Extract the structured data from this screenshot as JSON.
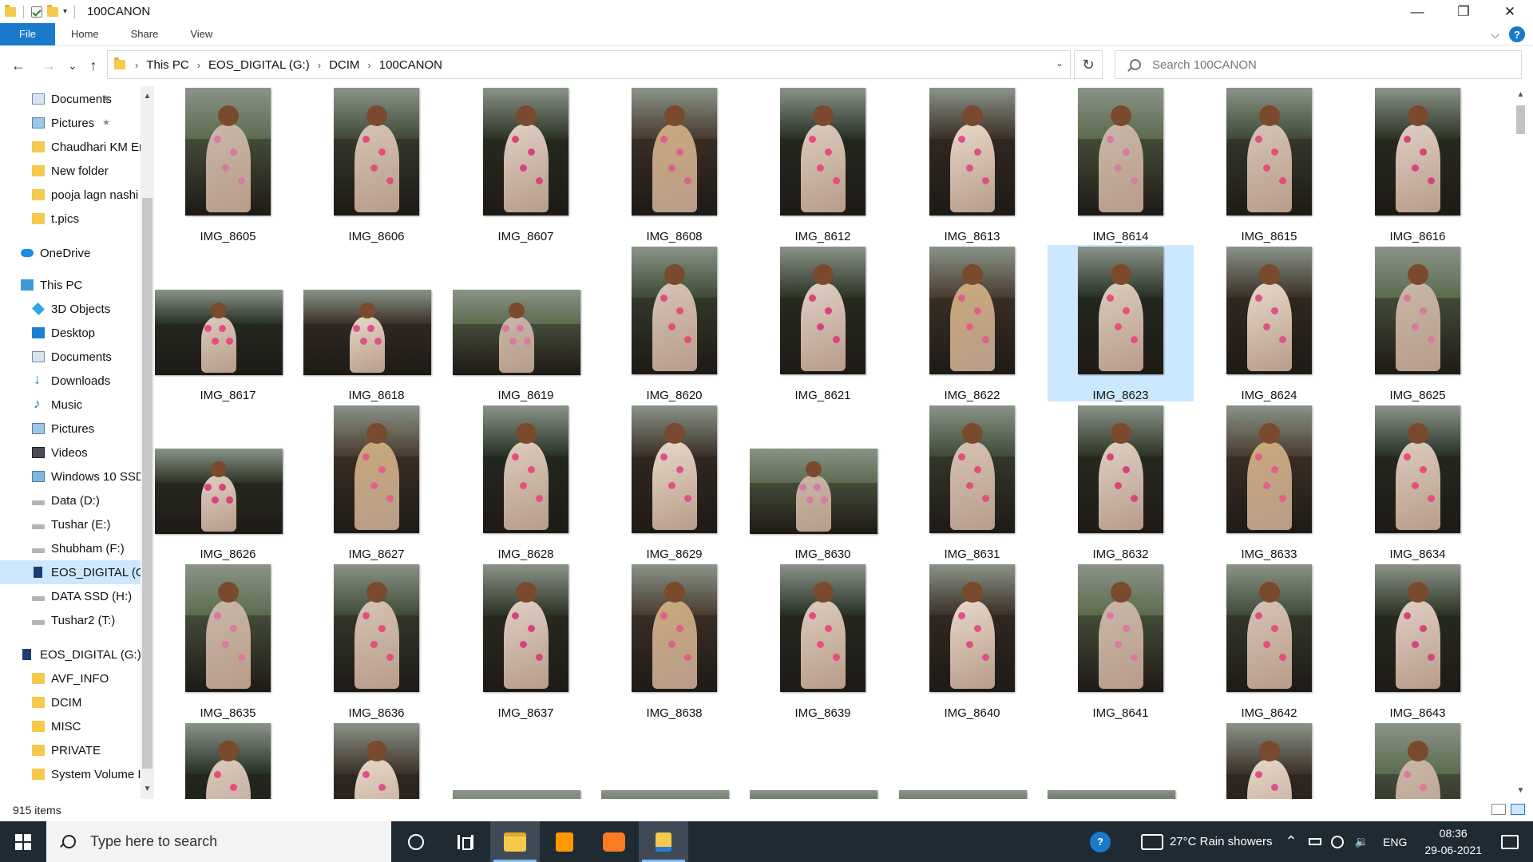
{
  "window": {
    "title": "100CANON",
    "controls": {
      "minimize": "—",
      "maximize": "❐",
      "close": "✕"
    },
    "help": "?"
  },
  "ribbon": {
    "tabs": [
      "File",
      "Home",
      "Share",
      "View"
    ],
    "expand": "⌵"
  },
  "nav": {
    "back": "←",
    "forward": "→",
    "recent": "⌄",
    "up": "↑"
  },
  "address": {
    "breadcrumbs": [
      "This PC",
      "EOS_DIGITAL (G:)",
      "DCIM",
      "100CANON"
    ],
    "separator": "›",
    "dropdown": "⌄",
    "refresh": "↻"
  },
  "search": {
    "placeholder": "Search 100CANON"
  },
  "sidebar": {
    "items": [
      {
        "label": "Documents",
        "icon": "documents-icon",
        "pinned": "★"
      },
      {
        "label": "Pictures",
        "icon": "pictures-icon",
        "pinned": "★"
      },
      {
        "label": "Chaudhari KM En",
        "icon": "folder-icon"
      },
      {
        "label": "New folder",
        "icon": "folder-icon"
      },
      {
        "label": "pooja lagn nashi",
        "icon": "folder-icon"
      },
      {
        "label": "t.pics",
        "icon": "folder-icon"
      },
      {
        "label": "OneDrive",
        "icon": "onedrive-icon"
      },
      {
        "label": "This PC",
        "icon": "this-pc-icon"
      },
      {
        "label": "3D Objects",
        "icon": "3d-objects-icon"
      },
      {
        "label": "Desktop",
        "icon": "desktop-icon"
      },
      {
        "label": "Documents",
        "icon": "documents-icon"
      },
      {
        "label": "Downloads",
        "icon": "downloads-icon"
      },
      {
        "label": "Music",
        "icon": "music-icon"
      },
      {
        "label": "Pictures",
        "icon": "pictures-icon"
      },
      {
        "label": "Videos",
        "icon": "videos-icon"
      },
      {
        "label": "Windows 10 SSD",
        "icon": "windows-drive-icon"
      },
      {
        "label": "Data (D:)",
        "icon": "drive-icon"
      },
      {
        "label": "Tushar (E:)",
        "icon": "drive-icon"
      },
      {
        "label": "Shubham (F:)",
        "icon": "drive-icon"
      },
      {
        "label": "EOS_DIGITAL (G:)",
        "icon": "sd-card-icon",
        "selected": true
      },
      {
        "label": "DATA SSD (H:)",
        "icon": "drive-icon"
      },
      {
        "label": "Tushar2 (T:)",
        "icon": "drive-icon"
      },
      {
        "label": "EOS_DIGITAL (G:)",
        "icon": "sd-card-icon"
      },
      {
        "label": "AVF_INFO",
        "icon": "folder-icon"
      },
      {
        "label": "DCIM",
        "icon": "folder-icon"
      },
      {
        "label": "MISC",
        "icon": "folder-icon"
      },
      {
        "label": "PRIVATE",
        "icon": "folder-icon"
      },
      {
        "label": "System Volume I",
        "icon": "folder-icon"
      }
    ],
    "scroll_up": "▲",
    "scroll_down": "▼"
  },
  "files": [
    {
      "name": "IMG_8605",
      "orientation": "portrait"
    },
    {
      "name": "IMG_8606",
      "orientation": "portrait"
    },
    {
      "name": "IMG_8607",
      "orientation": "portrait"
    },
    {
      "name": "IMG_8608",
      "orientation": "portrait"
    },
    {
      "name": "IMG_8612",
      "orientation": "portrait"
    },
    {
      "name": "IMG_8613",
      "orientation": "portrait"
    },
    {
      "name": "IMG_8614",
      "orientation": "portrait"
    },
    {
      "name": "IMG_8615",
      "orientation": "portrait"
    },
    {
      "name": "IMG_8616",
      "orientation": "portrait"
    },
    {
      "name": "IMG_8617",
      "orientation": "landscape"
    },
    {
      "name": "IMG_8618",
      "orientation": "landscape"
    },
    {
      "name": "IMG_8619",
      "orientation": "landscape"
    },
    {
      "name": "IMG_8620",
      "orientation": "portrait"
    },
    {
      "name": "IMG_8621",
      "orientation": "portrait"
    },
    {
      "name": "IMG_8622",
      "orientation": "portrait"
    },
    {
      "name": "IMG_8623",
      "orientation": "portrait",
      "selected": true
    },
    {
      "name": "IMG_8624",
      "orientation": "portrait"
    },
    {
      "name": "IMG_8625",
      "orientation": "portrait"
    },
    {
      "name": "IMG_8626",
      "orientation": "landscape"
    },
    {
      "name": "IMG_8627",
      "orientation": "portrait"
    },
    {
      "name": "IMG_8628",
      "orientation": "portrait"
    },
    {
      "name": "IMG_8629",
      "orientation": "portrait"
    },
    {
      "name": "IMG_8630",
      "orientation": "landscape"
    },
    {
      "name": "IMG_8631",
      "orientation": "portrait"
    },
    {
      "name": "IMG_8632",
      "orientation": "portrait"
    },
    {
      "name": "IMG_8633",
      "orientation": "portrait"
    },
    {
      "name": "IMG_8634",
      "orientation": "portrait"
    },
    {
      "name": "IMG_8635",
      "orientation": "portrait"
    },
    {
      "name": "IMG_8636",
      "orientation": "portrait"
    },
    {
      "name": "IMG_8637",
      "orientation": "portrait"
    },
    {
      "name": "IMG_8638",
      "orientation": "portrait"
    },
    {
      "name": "IMG_8639",
      "orientation": "portrait"
    },
    {
      "name": "IMG_8640",
      "orientation": "portrait"
    },
    {
      "name": "IMG_8641",
      "orientation": "portrait"
    },
    {
      "name": "IMG_8642",
      "orientation": "portrait"
    },
    {
      "name": "IMG_8643",
      "orientation": "portrait"
    },
    {
      "name": "",
      "orientation": "portrait"
    },
    {
      "name": "",
      "orientation": "portrait"
    },
    {
      "name": "",
      "orientation": "landscape"
    },
    {
      "name": "",
      "orientation": "landscape"
    },
    {
      "name": "",
      "orientation": "landscape"
    },
    {
      "name": "",
      "orientation": "landscape"
    },
    {
      "name": "",
      "orientation": "landscape"
    },
    {
      "name": "",
      "orientation": "portrait"
    },
    {
      "name": "",
      "orientation": "portrait"
    }
  ],
  "status": {
    "item_count": "915 items"
  },
  "taskbar": {
    "search_placeholder": "Type here to search",
    "weather": "27°C  Rain showers",
    "language": "ENG",
    "time": "08:36",
    "date": "29-06-2021",
    "help_tray": "?",
    "tray_chevron": "⌃",
    "volume": "🔉"
  },
  "colors": {
    "accent": "#1979ca",
    "selection": "#cce8ff",
    "taskbar": "#1f2a33"
  }
}
